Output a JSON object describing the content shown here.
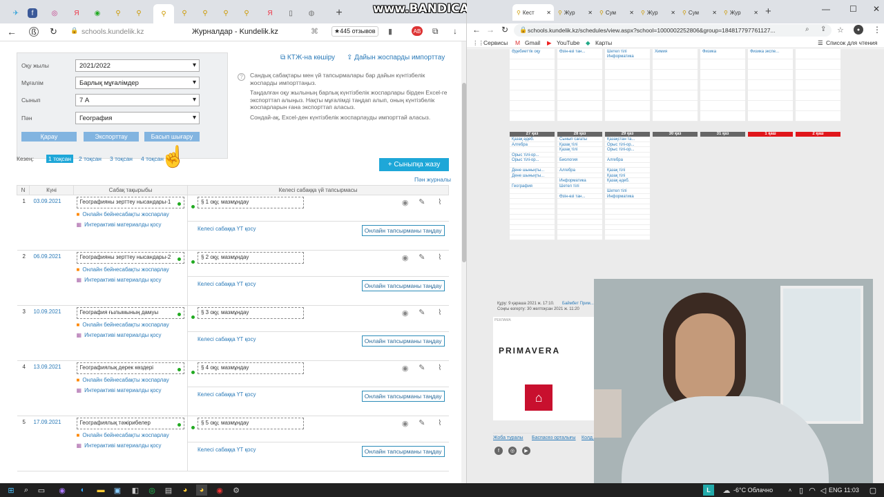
{
  "left_browser": {
    "tabs_icons": [
      "telegram-icon",
      "facebook-icon",
      "instagram-icon",
      "yandex-icon",
      "whatsapp-icon",
      "kundelik-icon",
      "kundelik-icon",
      "kundelik-icon",
      "kundelik-icon",
      "kundelik-icon",
      "kundelik-icon",
      "yandex-icon",
      "document-icon",
      "globe-icon"
    ],
    "new_tab": "+",
    "url": "schools.kundelik.kz",
    "page_title": "Журналдар - Kundelik.kz",
    "reviews": "★445 отзывов",
    "nav_icons": {
      "back": "←",
      "forward": "→"
    }
  },
  "filters": {
    "year_label": "Оқу жылы",
    "year_value": "2021/2022",
    "teacher_label": "Мұғалім",
    "teacher_value": "Барлық мұғалімдер",
    "class_label": "Сынып",
    "class_value": "7 А",
    "subject_label": "Пән",
    "subject_value": "География",
    "view_btn": "Қарау",
    "export_btn": "Экспорттау",
    "print_btn": "Басып шығару"
  },
  "actions": {
    "copy_ktzh": "КТЖ-на көшіру",
    "import_plan": "Дайын жоспарды импорттау"
  },
  "help": {
    "p1": "Сандық сабақтары мен үй тапсырмалары бар дайын күнтізбелік жоспарды импорттаңыз.",
    "p2": "Таңдалған оқу жылының барлық күнтізбелік жоспарлары бірден Excel-ге экспорттап алыңыз. Нақты мұғалімді таңдап алып, оның күнтізбелік жоспарларын ғана экспорттап аласыз.",
    "p3": "Сондай-ақ, Excel-ден күнтізбелік жоспарлауды импорттай аласыз."
  },
  "period": {
    "label": "Кезең:",
    "items": [
      "1 тоқсан",
      "2 тоқсан",
      "3 тоқсан",
      "4 тоқсан"
    ]
  },
  "add_class_btn": "+ Сыныпқа жазу",
  "subject_journal_link": "Пән журналы",
  "table": {
    "headers": [
      "N",
      "Күні",
      "Сабақ тақырыбы",
      "Келесі сабаққа үй тапсырмасы"
    ],
    "online_lesson": "Онлайн бейнесабақты жоспарлау",
    "interactive": "Интерактиві материалды қосу",
    "add_hw": "Келесі сабаққа ҮТ қосу",
    "choose_online": "Онлайн тапсырманы таңдау",
    "rows": [
      {
        "n": "1",
        "date": "03.09.2021",
        "topic": "Географияны зерттеу нысандары-1",
        "hw": "§ 1 оқу, мазмұндау"
      },
      {
        "n": "2",
        "date": "06.09.2021",
        "topic": "Географияны зерттеу нысандары-2",
        "hw": "§ 2 оқу, мазмұндау"
      },
      {
        "n": "3",
        "date": "10.09.2021",
        "topic": "География ғылымының дамуы",
        "hw": "§ 3 оқу, мазмұндау"
      },
      {
        "n": "4",
        "date": "13.09.2021",
        "topic": "Географиялық дерек көздері",
        "hw": "§ 4 оқу, мазмұндау"
      },
      {
        "n": "5",
        "date": "17.09.2021",
        "topic": "Географиялық тәжірибелер",
        "hw": "§ 5 оқу, мазмұндау"
      }
    ]
  },
  "bandicam": "www.BANDICAM.com",
  "right_browser": {
    "tabs": [
      "Кест",
      "Жур",
      "Сум",
      "Жур",
      "Сум",
      "Жур"
    ],
    "url": "schools.kundelik.kz/schedules/view.aspx?school=1000002252806&group=184817797761127...",
    "bookmarks": [
      "Сервисы",
      "Gmail",
      "YouTube",
      "Карты"
    ],
    "reading_list": "Список для чтения",
    "top_slots": [
      [
        "Әдебиеттік оқу"
      ],
      [
        "Өзін-өзі тан..."
      ],
      [
        "Шетел тілі",
        "Информатика"
      ],
      [
        "Химия"
      ],
      [
        "Физика"
      ],
      [
        "Физика экспе..."
      ],
      []
    ],
    "days": [
      "27 қаз",
      "28 қаз",
      "29 қаз",
      "30 қаз",
      "31 қаз",
      "1 қаш",
      "2 қаш"
    ],
    "week": [
      [
        "Қазақ әдеб.",
        "Алгебра",
        "",
        "Орыс тілі-ор...",
        "Орыс тілі-ор...",
        "",
        "Дене шынықты...",
        "Дене шынықты...",
        "",
        "География",
        "",
        ""
      ],
      [
        "Сынып сағаты",
        "Қазақ тілі",
        "Қазақ тілі",
        "",
        "Биология",
        "",
        "Алгебра",
        "",
        "Информатика",
        "Шетел тілі",
        "",
        "Өзін-өзі тан..."
      ],
      [
        "Қазақстан та...",
        "Орыс тілі-ор...",
        "Орыс тілі-ор...",
        "",
        "Алгебра",
        "",
        "Қазақ тілі",
        "Қазақ тілі",
        "Қазақ әдеб.",
        "",
        "Шетел тілі",
        "Информатика"
      ]
    ],
    "created": "Құру: 9 қараша 2021 ж. 17:10.",
    "creator": "Баймбет Прим...",
    "last_change": "Соңғы өзгерту: 30 желтоқсан 2021 ж. 11:20",
    "ad_label": "РЕКЛАМА",
    "ad_brand": "PRIMAVERA",
    "footer_links": [
      "Жоба туралы",
      "Баспасөз орталығы",
      "Колд..."
    ]
  },
  "taskbar": {
    "weather": "-6°C Облачно",
    "lang": "ENG",
    "time": "11:03",
    "app_icons": [
      "windows-icon",
      "search-icon",
      "taskview-icon",
      "app-icon",
      "edge-icon",
      "explorer-icon",
      "store-icon",
      "whatsapp-icon",
      "files-icon",
      "chrome-icon",
      "chrome-icon",
      "record-icon",
      "settings-icon"
    ]
  }
}
